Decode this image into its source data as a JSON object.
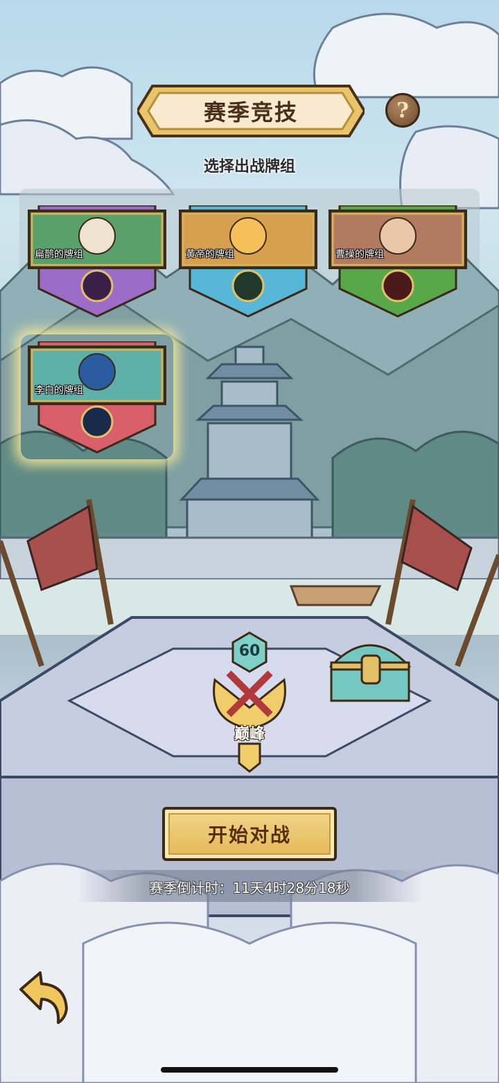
{
  "header": {
    "title": "赛季竞技",
    "help_symbol": "?"
  },
  "subtitle": "选择出战牌组",
  "decks": [
    {
      "label": "扁鹊的牌组",
      "theme": "#9b6cc8",
      "selected": false
    },
    {
      "label": "黄帝的牌组",
      "theme": "#56b8d6",
      "selected": false
    },
    {
      "label": "曹操的牌组",
      "theme": "#58a84a",
      "selected": false
    },
    {
      "label": "李白的牌组",
      "theme": "#d9606a",
      "selected": true
    }
  ],
  "rank": {
    "level": "60",
    "name": "巅峰"
  },
  "start_button": "开始对战",
  "countdown": "赛季倒计时：11天4时28分18秒",
  "colors": {
    "gold": "#e3b957",
    "dark_brown": "#3b2a14"
  }
}
